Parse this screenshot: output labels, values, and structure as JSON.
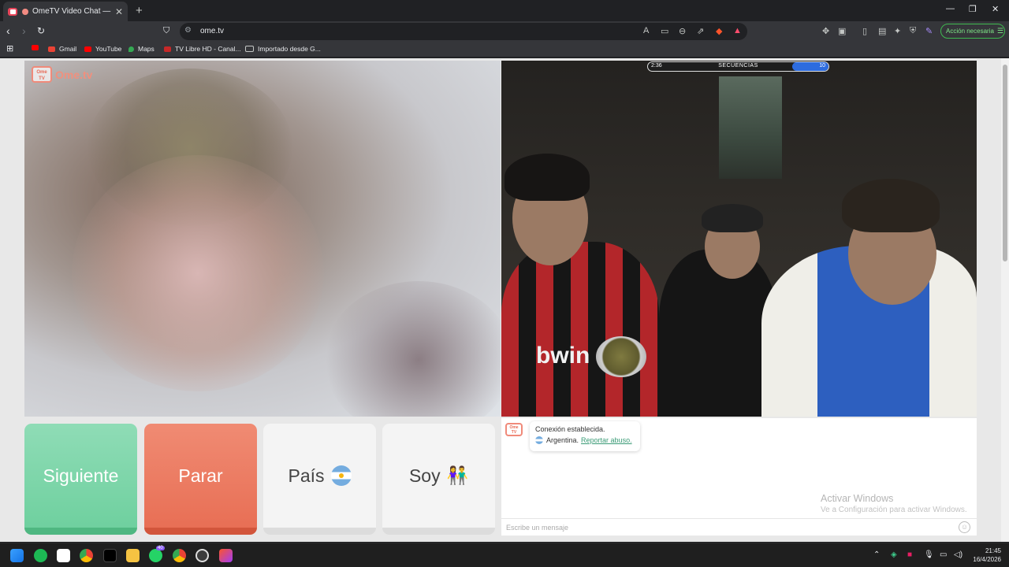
{
  "browser": {
    "tab_title": "OmeTV Video Chat — Omeg",
    "tab_close": "✕",
    "new_tab": "+",
    "url": "ome.tv",
    "action_button": "Acción necesaria"
  },
  "bookmarks": [
    {
      "label": "Gmail",
      "color": "#ea4335"
    },
    {
      "label": "YouTube",
      "color": "#ff0000"
    },
    {
      "label": "Maps",
      "color": "#34a853"
    },
    {
      "label": "TV Libre HD - Canal...",
      "color": "#c62828"
    },
    {
      "label": "Importado desde G...",
      "color": "#9aa0a6"
    }
  ],
  "site": {
    "logo_badge": "Ome TV",
    "logo_text": "Ome.tv"
  },
  "capture_bar": {
    "left": "2:36",
    "center": "SECUENCIAS",
    "right": "10"
  },
  "stranger_shirt_text": "bwin",
  "buttons": {
    "next": "Siguiente",
    "stop": "Parar",
    "country": "País",
    "gender": "Soy"
  },
  "chat": {
    "logo_badge": "Ome TV",
    "status": "Conexión establecida.",
    "country": "Argentina.",
    "report": "Reportar abuso.",
    "placeholder": "Escribe un mensaje",
    "watermark_title": "Activar Windows",
    "watermark_sub": "Ve a Configuración para activar Windows."
  },
  "taskbar": {
    "whatsapp_badge": "40",
    "time": "21:45",
    "date": "16/4/2026"
  },
  "colors": {
    "next": "#6fd09f",
    "stop": "#e86f55",
    "accent_link": "#3a9b76"
  }
}
